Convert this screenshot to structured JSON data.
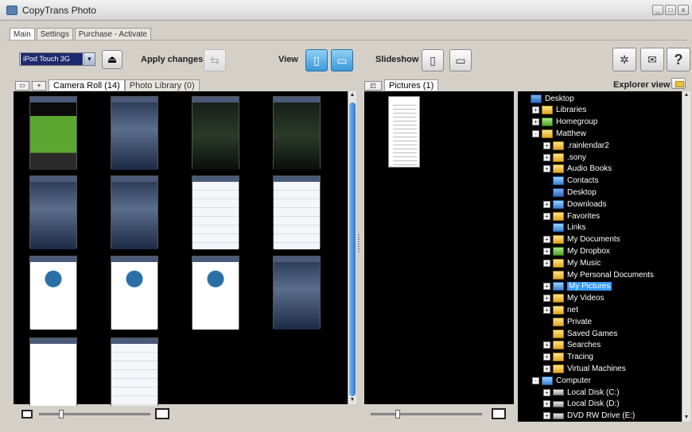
{
  "window": {
    "title": "CopyTrans Photo"
  },
  "menu_tabs": [
    "Main",
    "Settings",
    "Purchase - Activate"
  ],
  "toolbar": {
    "device_value": "iPod Touch 3G",
    "apply_label": "Apply changes",
    "view_label": "View",
    "slideshow_label": "Slideshow"
  },
  "left_pane": {
    "tabs": [
      "Camera Roll (14)",
      "Photo Library (0)"
    ],
    "active_tab": 0,
    "thumbnail_styles": [
      "t-green",
      "t-dialog",
      "t-dark",
      "t-dark",
      "t-dialog",
      "t-dialog",
      "t-form",
      "t-form",
      "t-wp",
      "t-wp",
      "t-wp",
      "t-dialog",
      "t-doc",
      "t-form"
    ]
  },
  "middle_pane": {
    "tabs": [
      "Pictures (1)"
    ]
  },
  "explorer": {
    "label": "Explorer view",
    "tree": [
      {
        "label": "Desktop",
        "depth": 0,
        "icon": "desk",
        "exp": "none"
      },
      {
        "label": "Libraries",
        "depth": 1,
        "icon": "folder",
        "exp": "+"
      },
      {
        "label": "Homegroup",
        "depth": 1,
        "icon": "green",
        "exp": "+"
      },
      {
        "label": "Matthew",
        "depth": 1,
        "icon": "folder",
        "exp": "-"
      },
      {
        "label": ".rainlendar2",
        "depth": 2,
        "icon": "folder",
        "exp": "+"
      },
      {
        "label": ".sony",
        "depth": 2,
        "icon": "folder",
        "exp": "+"
      },
      {
        "label": "Audio Books",
        "depth": 2,
        "icon": "folder",
        "exp": "+"
      },
      {
        "label": "Contacts",
        "depth": 2,
        "icon": "blue",
        "exp": "none"
      },
      {
        "label": "Desktop",
        "depth": 2,
        "icon": "desk",
        "exp": "none"
      },
      {
        "label": "Downloads",
        "depth": 2,
        "icon": "blue",
        "exp": "+"
      },
      {
        "label": "Favorites",
        "depth": 2,
        "icon": "folder",
        "exp": "+"
      },
      {
        "label": "Links",
        "depth": 2,
        "icon": "blue",
        "exp": "none"
      },
      {
        "label": "My Documents",
        "depth": 2,
        "icon": "folder",
        "exp": "+"
      },
      {
        "label": "My Dropbox",
        "depth": 2,
        "icon": "green",
        "exp": "+"
      },
      {
        "label": "My Music",
        "depth": 2,
        "icon": "folder",
        "exp": "+"
      },
      {
        "label": "My Personal Documents",
        "depth": 2,
        "icon": "folder",
        "exp": "none"
      },
      {
        "label": "My Pictures",
        "depth": 2,
        "icon": "blue",
        "exp": "+",
        "selected": true
      },
      {
        "label": "My Videos",
        "depth": 2,
        "icon": "folder",
        "exp": "+"
      },
      {
        "label": "net",
        "depth": 2,
        "icon": "folder",
        "exp": "+"
      },
      {
        "label": "Private",
        "depth": 2,
        "icon": "folder",
        "exp": "none"
      },
      {
        "label": "Saved Games",
        "depth": 2,
        "icon": "folder",
        "exp": "none"
      },
      {
        "label": "Searches",
        "depth": 2,
        "icon": "folder",
        "exp": "+"
      },
      {
        "label": "Tracing",
        "depth": 2,
        "icon": "folder",
        "exp": "+"
      },
      {
        "label": "Virtual Machines",
        "depth": 2,
        "icon": "folder",
        "exp": "+"
      },
      {
        "label": "Computer",
        "depth": 1,
        "icon": "blue",
        "exp": "-"
      },
      {
        "label": "Local Disk (C:)",
        "depth": 2,
        "icon": "drive",
        "exp": "+"
      },
      {
        "label": "Local Disk (D:)",
        "depth": 2,
        "icon": "drive",
        "exp": "+"
      },
      {
        "label": "DVD RW Drive (E:)",
        "depth": 2,
        "icon": "drive",
        "exp": "+"
      }
    ]
  }
}
